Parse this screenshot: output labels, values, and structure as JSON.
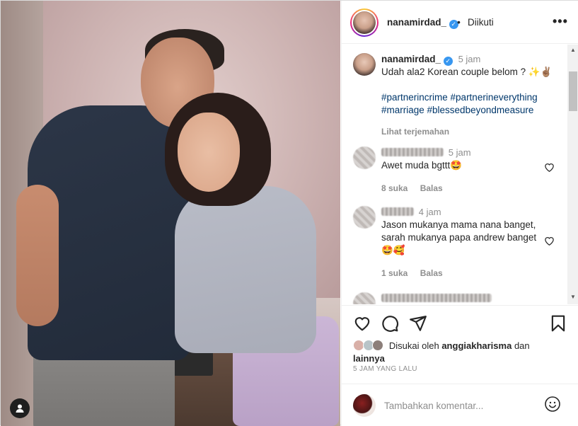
{
  "post": {
    "username": "nanamirdad_",
    "follow_state": "Diikuti",
    "separator": "•",
    "more_label": "•••"
  },
  "caption": {
    "username": "nanamirdad_",
    "time": "5 jam",
    "text": "Udah ala2 Korean couple belom ? ✨✌🏽",
    "hashtags": "#partnerincrime #partnerineverything #marriage #blessedbeyondmeasure",
    "translate_label": "Lihat terjemahan"
  },
  "comments": [
    {
      "time": "5 jam",
      "text": "Awet muda bgttt🤩",
      "likes": "8 suka",
      "reply_label": "Balas"
    },
    {
      "time": "4 jam",
      "text": "Jason mukanya mama nana banget, sarah mukanya papa andrew banget 🤩🥰",
      "likes": "1 suka",
      "reply_label": "Balas"
    }
  ],
  "liked_by": {
    "prefix": "Disukai oleh",
    "user": "anggiakharisma",
    "and": "dan",
    "others": "lainnya"
  },
  "time_ago": "5 JAM YANG LALU",
  "add_comment": {
    "placeholder": "Tambahkan komentar..."
  },
  "icons": [
    "user-tag-icon",
    "verified-icon",
    "more-icon",
    "heart-icon",
    "comment-icon",
    "share-icon",
    "bookmark-icon",
    "emoji-icon"
  ],
  "colors": {
    "link_blue": "#00376b",
    "verified_blue": "#3897f0",
    "muted_gray": "#8e8e8e",
    "text": "#262626"
  }
}
